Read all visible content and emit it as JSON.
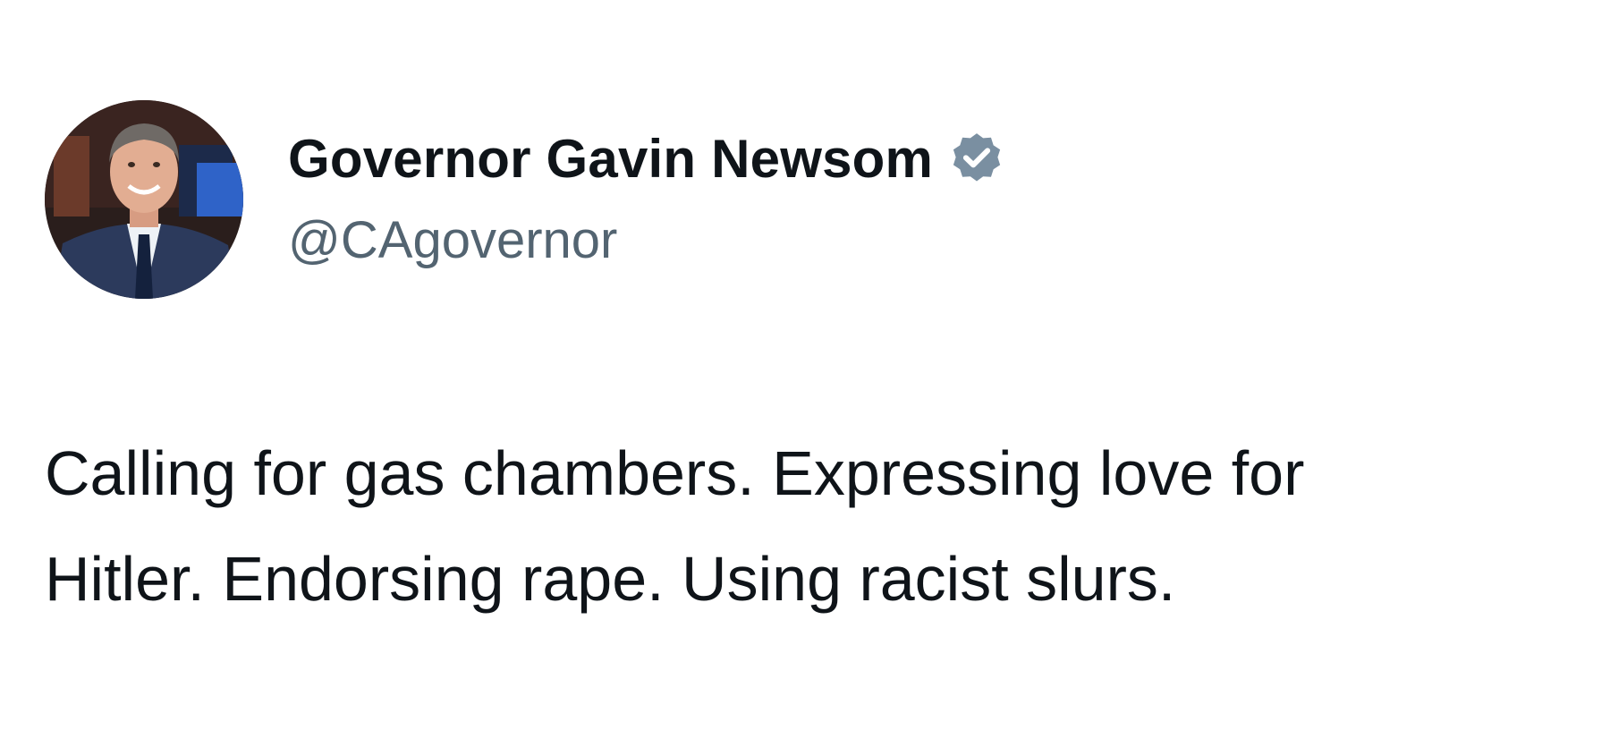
{
  "author": {
    "display_name": "Governor Gavin Newsom",
    "handle": "@CAgovernor",
    "verified": true,
    "verified_badge_color": "#7a8fa1",
    "avatar_icon": "profile-photo"
  },
  "tweet": {
    "lines": [
      "Calling for gas chambers. Expressing love for",
      "Hitler. Endorsing rape. Using racist slurs."
    ]
  },
  "colors": {
    "text_primary": "#0f1419",
    "text_secondary": "#536471",
    "background": "#ffffff"
  }
}
